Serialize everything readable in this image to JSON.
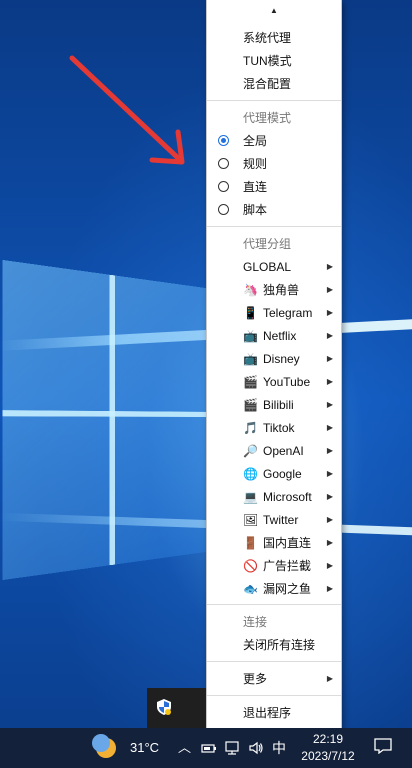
{
  "menu": {
    "scroll_up": "▲",
    "top_items": [
      "系统代理",
      "TUN模式",
      "混合配置"
    ],
    "proxy_mode": {
      "header": "代理模式",
      "options": [
        {
          "label": "全局",
          "selected": true
        },
        {
          "label": "规则",
          "selected": false
        },
        {
          "label": "直连",
          "selected": false
        },
        {
          "label": "脚本",
          "selected": false
        }
      ]
    },
    "proxy_groups": {
      "header": "代理分组",
      "groups": [
        {
          "label": "GLOBAL",
          "icon": "",
          "icon_name": ""
        },
        {
          "label": "独角兽",
          "icon": "🦄",
          "icon_name": "unicorn-icon"
        },
        {
          "label": "Telegram",
          "icon": "📱",
          "icon_name": "phone-icon"
        },
        {
          "label": "Netflix",
          "icon": "📺",
          "icon_name": "tv-icon"
        },
        {
          "label": "Disney",
          "icon": "📺",
          "icon_name": "tv-icon"
        },
        {
          "label": "YouTube",
          "icon": "🎬",
          "icon_name": "clapper-icon"
        },
        {
          "label": "Bilibili",
          "icon": "🎬",
          "icon_name": "clapper-icon"
        },
        {
          "label": "Tiktok",
          "icon": "🎵",
          "icon_name": "music-note-icon"
        },
        {
          "label": "OpenAI",
          "icon": "🔎",
          "icon_name": "magnifier-icon"
        },
        {
          "label": "Google",
          "icon": "🌐",
          "icon_name": "globe-icon"
        },
        {
          "label": "Microsoft",
          "icon": "💻",
          "icon_name": "computer-icon"
        },
        {
          "label": "Twitter",
          "icon": "🖼",
          "icon_name": "picture-icon"
        },
        {
          "label": "国内直连",
          "icon": "🚪",
          "icon_name": "door-icon"
        },
        {
          "label": "广告拦截",
          "icon": "🚫",
          "icon_name": "prohibited-icon"
        },
        {
          "label": "漏网之鱼",
          "icon": "🐟",
          "icon_name": "fish-icon"
        }
      ]
    },
    "connection": {
      "header": "连接",
      "close_all": "关闭所有连接"
    },
    "more": "更多",
    "quit": "退出程序"
  },
  "taskbar": {
    "temperature": "31°C",
    "ime": "中",
    "time": "22:19",
    "date": "2023/7/12"
  },
  "colors": {
    "accent": "#1e6fe0",
    "annotation_arrow": "#e53935"
  }
}
